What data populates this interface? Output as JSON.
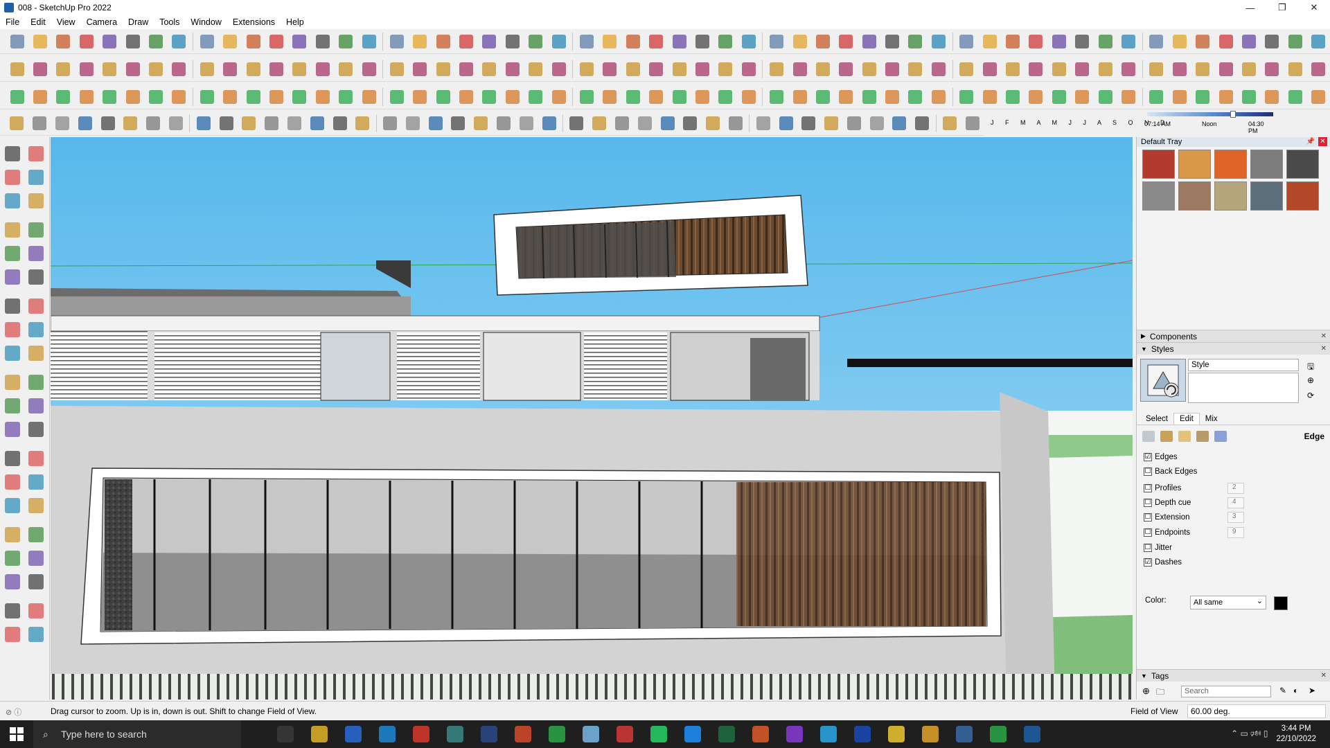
{
  "window": {
    "title": "008 - SketchUp Pro 2022",
    "min_icon": "minimize-icon",
    "max_icon": "maximize-icon",
    "close_icon": "close-icon"
  },
  "menu": {
    "items": [
      "File",
      "Edit",
      "View",
      "Camera",
      "Draw",
      "Tools",
      "Window",
      "Extensions",
      "Help"
    ]
  },
  "shadow": {
    "months": "J F M A M J J A S O N D",
    "time_start": "07:14 AM",
    "time_mid": "Noon",
    "time_end": "04:30 PM",
    "time_level": 0.66
  },
  "tray": {
    "title": "Default Tray",
    "materials": [
      "#b33a2f",
      "#d9974a",
      "#e0642a",
      "#7d7d7d",
      "#4a4a4a",
      "#8a8a8a",
      "#9c7a62",
      "#b4a57a",
      "#5d6f7a",
      "#b4492a"
    ],
    "components_label": "Components",
    "styles_label": "Styles",
    "style_name": "Style",
    "style_desc": "",
    "tabs": [
      "Select",
      "Edit",
      "Mix"
    ],
    "active_tab": "Edit",
    "edit_section": "Edge",
    "edge_settings": [
      {
        "label": "Edges",
        "checked": "☑",
        "value": ""
      },
      {
        "label": "Back Edges",
        "checked": "☐",
        "value": ""
      },
      {
        "label": "Profiles",
        "checked": "☐",
        "value": "2"
      },
      {
        "label": "Depth cue",
        "checked": "☐",
        "value": "4"
      },
      {
        "label": "Extension",
        "checked": "☐",
        "value": "3"
      },
      {
        "label": "Endpoints",
        "checked": "☐",
        "value": "9"
      },
      {
        "label": "Jitter",
        "checked": "☐",
        "value": ""
      },
      {
        "label": "Dashes",
        "checked": "☑",
        "value": ""
      }
    ],
    "color_label": "Color:",
    "color_mode": "All same",
    "color_value": "#000000",
    "tags_label": "Tags",
    "tags_search_placeholder": "Search"
  },
  "status": {
    "message": "Drag cursor to zoom.  Up is in, down is out. Shift to change Field of View.",
    "fov_label": "Field of View",
    "fov_value": "60.00 deg."
  },
  "taskbar": {
    "search_placeholder": "Type here to search",
    "time": "3:44 PM",
    "date": "22/10/2022"
  }
}
